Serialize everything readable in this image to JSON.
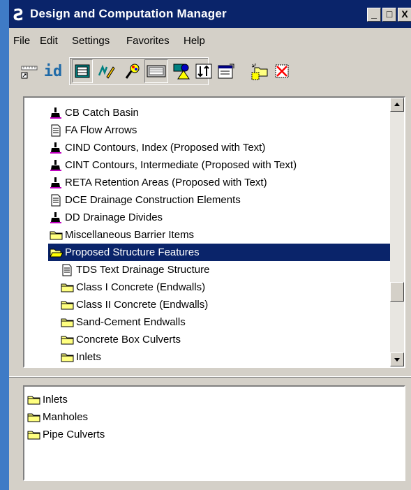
{
  "window": {
    "title": "Design and Computation Manager",
    "controls": {
      "minimize": "_",
      "maximize": "□",
      "close": "X"
    }
  },
  "menu": [
    {
      "label": "File"
    },
    {
      "label": "Edit"
    },
    {
      "label": "Settings"
    },
    {
      "label": "Favorites"
    },
    {
      "label": "Help"
    }
  ],
  "toolbar": {
    "id_label": "id",
    "tools": [
      "ruler-attach-icon",
      "id-icon",
      "grid-view-icon",
      "pencil-edit-icon",
      "paint-palette-icon",
      "keyboard-icon",
      "symbol-shapes-icon",
      "sort-arrows-icon",
      "properties-icon",
      "new-folder-icon",
      "delete-icon"
    ]
  },
  "tree": {
    "items": [
      {
        "label": "CB Catch Basin",
        "icon": "paintbrush-icon"
      },
      {
        "label": "FA Flow Arrows",
        "icon": "document-icon"
      },
      {
        "label": "CIND Contours, Index (Proposed with Text)",
        "icon": "paintbrush-icon"
      },
      {
        "label": "CINT Contours, Intermediate (Proposed with Text)",
        "icon": "paintbrush-icon"
      },
      {
        "label": "RETA Retention Areas (Proposed with Text)",
        "icon": "paintbrush-icon"
      },
      {
        "label": "DCE Drainage Construction Elements",
        "icon": "document-icon"
      },
      {
        "label": "DD Drainage Divides",
        "icon": "paintbrush-icon"
      },
      {
        "label": "Miscellaneous Barrier Items",
        "icon": "folder-icon"
      },
      {
        "label": "Proposed Structure Features",
        "icon": "folder-open-icon",
        "selected": true
      },
      {
        "label": "TDS Text Drainage Structure",
        "icon": "document-icon"
      },
      {
        "label": "Class I Concrete (Endwalls)",
        "icon": "folder-icon"
      },
      {
        "label": "Class II Concrete (Endwalls)",
        "icon": "folder-icon"
      },
      {
        "label": "Sand-Cement Endwalls",
        "icon": "folder-icon"
      },
      {
        "label": "Concrete Box Culverts",
        "icon": "folder-icon"
      },
      {
        "label": "Inlets",
        "icon": "folder-icon"
      }
    ]
  },
  "detail": {
    "items": [
      {
        "label": "Inlets",
        "icon": "folder-icon"
      },
      {
        "label": "Manholes",
        "icon": "folder-icon"
      },
      {
        "label": "Pipe Culverts",
        "icon": "folder-icon"
      }
    ]
  },
  "colors": {
    "desktop": "#3f7bc6",
    "titlebar": "#0a246a",
    "face": "#d4d0c8",
    "selection": "#0a246a",
    "folder": "#ffff80"
  }
}
